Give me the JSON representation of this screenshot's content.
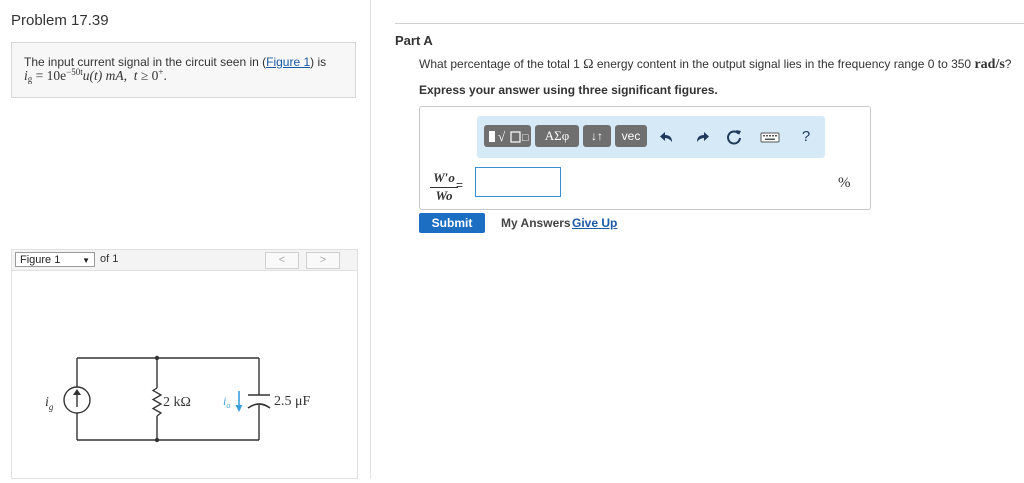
{
  "problem": {
    "title": "Problem 17.39",
    "intro_text": "The input current signal in the circuit seen in (",
    "figure_link": "Figure 1",
    "intro_text_end": ") is",
    "equation": {
      "lhs_var": "i",
      "lhs_sub": "g",
      "coef": "10e",
      "exponent": "−50t",
      "func": "u(t) mA,",
      "cond_var": "t",
      "cond_op": "≥",
      "cond_val": "0",
      "cond_sup": "+",
      "end": "."
    }
  },
  "figure_nav": {
    "selected": "Figure 1",
    "of_label": "of 1",
    "prev": "<",
    "next": ">"
  },
  "circuit": {
    "source_label": "i",
    "source_sub": "g",
    "resistor_label": "2 kΩ",
    "current_label": "i",
    "current_sub": "o",
    "capacitor_label": "2.5 μF"
  },
  "part": {
    "title": "Part A",
    "question_pre": "What percentage of the total 1 ",
    "question_ohm": "Ω",
    "question_mid": " energy content in the output signal lies in the frequency range 0 to 350 ",
    "question_unit": "rad/s",
    "question_end": "?",
    "instruction": "Express your answer using three significant figures."
  },
  "toolbar": {
    "templates_icon": "templates-icon",
    "greek_label": "ΑΣφ",
    "arrows_icon": "up-down-arrows-icon",
    "vec_label": "vec",
    "undo_icon": "undo-icon",
    "redo_icon": "redo-icon",
    "reset_icon": "reset-icon",
    "keyboard_icon": "keyboard-icon",
    "help_label": "?"
  },
  "answer": {
    "lhs_num": "W′o",
    "lhs_den": "Wo",
    "equals": "=",
    "value": "",
    "unit": "%"
  },
  "actions": {
    "submit": "Submit",
    "my_answers": "My Answers",
    "give_up": "Give Up"
  },
  "colors": {
    "accent": "#1b6ec2",
    "toolbar_bg": "#d5e9f7",
    "current_arrow": "#3aa0e0"
  }
}
